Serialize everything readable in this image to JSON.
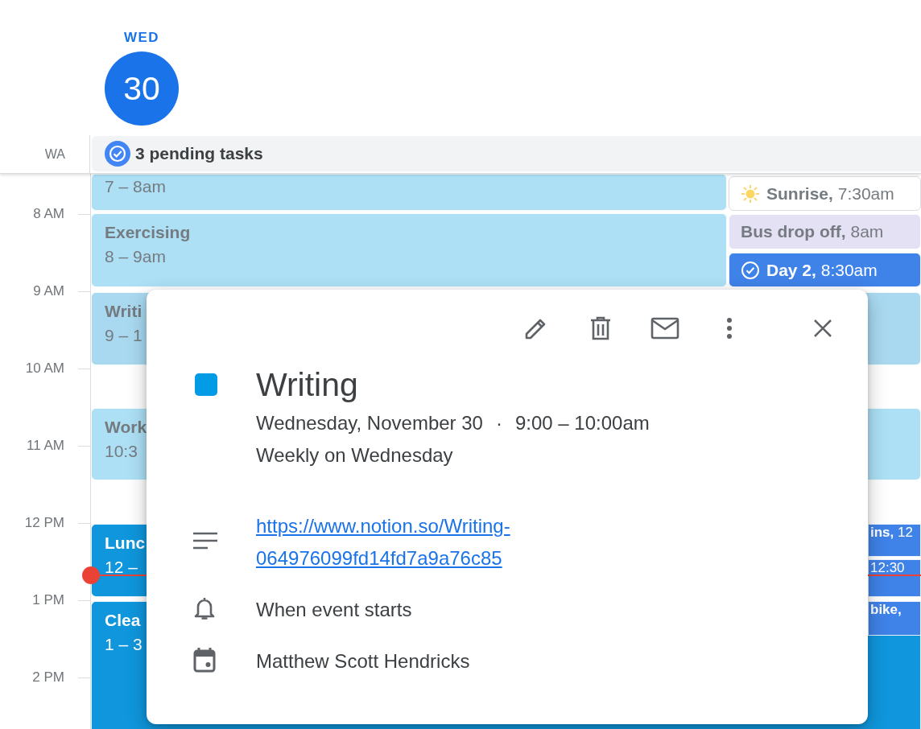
{
  "day_header": {
    "weekday": "WED",
    "day": "30",
    "today": true
  },
  "timezone_label": "WA",
  "all_day": {
    "text": "3 pending tasks"
  },
  "hours": [
    "8 AM",
    "9 AM",
    "10 AM",
    "11 AM",
    "12 PM",
    "1 PM",
    "2 PM"
  ],
  "events": [
    {
      "time": "7 – 8am",
      "color": "#ade0f5",
      "past": true
    },
    {
      "title": "Exercising",
      "time": "8 – 9am",
      "color": "#ade0f5",
      "past": true
    },
    {
      "title": "Writi",
      "time": "9 – 1",
      "color": "#a9d9f0",
      "past": true
    },
    {
      "title": "Work",
      "time": "10:3",
      "color": "#ade0f5",
      "past": true
    },
    {
      "title": "Lunc",
      "time": "12 –",
      "color": "#0f96dc",
      "past": false
    },
    {
      "title": "Clea",
      "time": "1 – 3",
      "color": "#0f96dc",
      "past": false
    }
  ],
  "side_events": [
    {
      "kind": "sunrise",
      "text": "**Sunrise,** 7:30am",
      "color": "#ffffff",
      "past": true
    },
    {
      "kind": "event",
      "text": "**Bus drop off,** 8am",
      "color": "#e4e1f5",
      "past": true
    },
    {
      "kind": "task",
      "text": "**Day 2,** 8:30am",
      "color": "#3f82e8",
      "past": false
    },
    {
      "kind": "event",
      "text": "**ins,** 12",
      "color": "#3f82e8",
      "past": false
    },
    {
      "kind": "event",
      "text": "12:30",
      "color": "#3f82e8",
      "past": false
    },
    {
      "kind": "event",
      "text": "**bike,**",
      "color": "#3f82e8",
      "past": false
    }
  ],
  "popup": {
    "title": "Writing",
    "color": "#039be5",
    "date": "Wednesday, November 30",
    "separator": "·",
    "time": "9:00 – 10:00am",
    "recurrence": "Weekly on Wednesday",
    "description_link": "https://www.notion.so/Writing-064976099fd14fd7a9a76c85",
    "reminder": "When event starts",
    "calendar": "Matthew Scott Hendricks"
  }
}
